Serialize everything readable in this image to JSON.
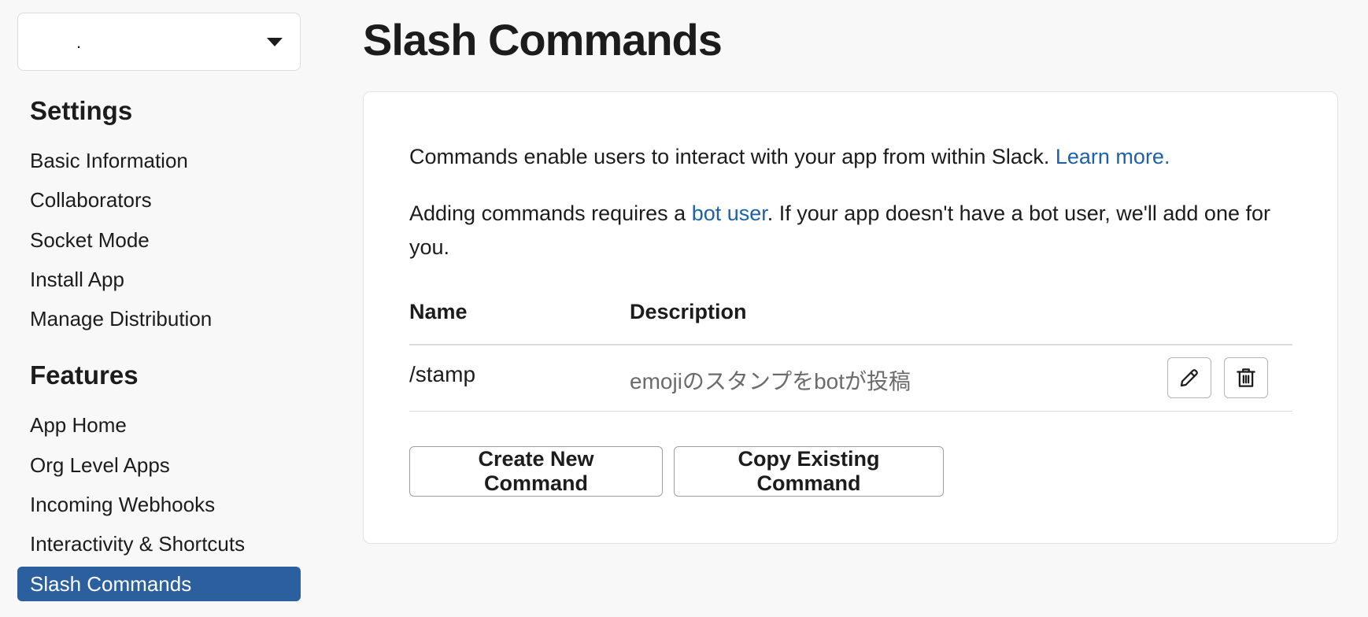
{
  "sidebar": {
    "app_selector": {
      "value": ".",
      "icon": "chevron-down-icon"
    },
    "settings_title": "Settings",
    "settings_items": [
      {
        "label": "Basic Information"
      },
      {
        "label": "Collaborators"
      },
      {
        "label": "Socket Mode"
      },
      {
        "label": "Install App"
      },
      {
        "label": "Manage Distribution"
      }
    ],
    "features_title": "Features",
    "features_items": [
      {
        "label": "App Home"
      },
      {
        "label": "Org Level Apps"
      },
      {
        "label": "Incoming Webhooks"
      },
      {
        "label": "Interactivity & Shortcuts"
      },
      {
        "label": "Slash Commands",
        "active": true
      }
    ]
  },
  "main": {
    "title": "Slash Commands",
    "intro": {
      "text": "Commands enable users to interact with your app from within Slack. ",
      "link": "Learn more."
    },
    "bot_note": {
      "before": "Adding commands requires a ",
      "link": "bot user",
      "after": ". If your app doesn't have a bot user, we'll add one for you."
    },
    "table": {
      "headers": {
        "name": "Name",
        "description": "Description"
      },
      "rows": [
        {
          "name": "/stamp",
          "description": "emojiのスタンプをbotが投稿"
        }
      ]
    },
    "buttons": {
      "create": "Create New Command",
      "copy": "Copy Existing Command"
    }
  },
  "colors": {
    "accent": "#2c5f9e",
    "link": "#1d61a8",
    "background": "#f8f8f8"
  }
}
